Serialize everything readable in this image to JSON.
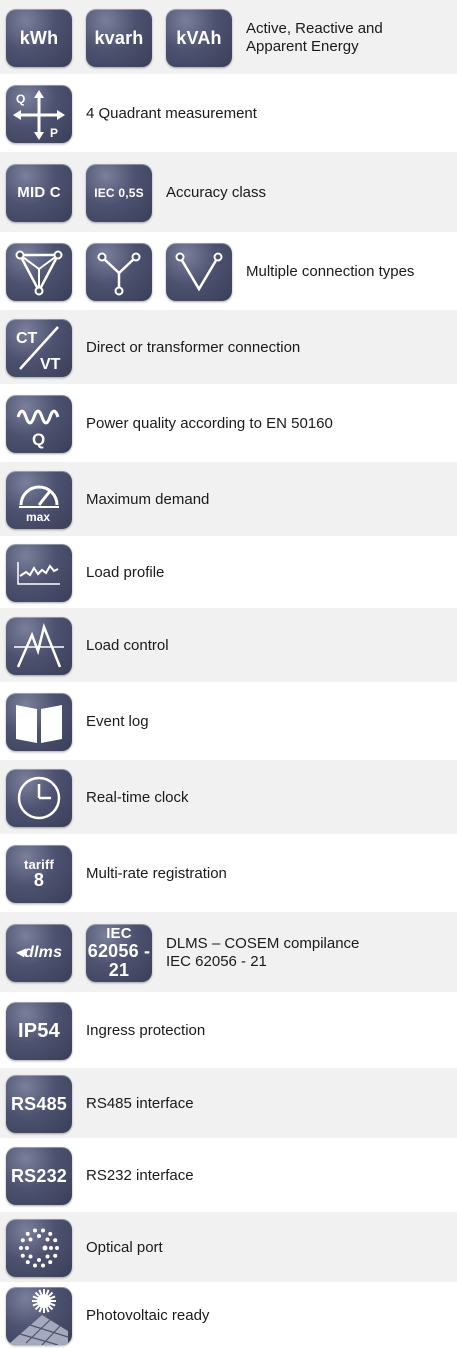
{
  "features": [
    {
      "icons": [
        "kWh",
        "kvarh",
        "kVAh"
      ],
      "label": "Active, Reactive and\nApparent Energy"
    },
    {
      "icons": [
        "quadrant-icon"
      ],
      "label": "4 Quadrant measurement"
    },
    {
      "icons": [
        "MID C",
        "IEC 0,5S"
      ],
      "label": "Accuracy class"
    },
    {
      "icons": [
        "delta-connection-icon",
        "star-connection-icon",
        "v-connection-icon"
      ],
      "label": "Multiple connection types"
    },
    {
      "icons": [
        "ct-vt-icon"
      ],
      "label": "Direct or transformer connection"
    },
    {
      "icons": [
        "power-quality-icon"
      ],
      "label": "Power quality according to EN 50160"
    },
    {
      "icons": [
        "max-demand-icon"
      ],
      "label": "Maximum demand"
    },
    {
      "icons": [
        "load-profile-icon"
      ],
      "label": "Load profile"
    },
    {
      "icons": [
        "load-control-icon"
      ],
      "label": "Load control"
    },
    {
      "icons": [
        "event-log-icon"
      ],
      "label": "Event log"
    },
    {
      "icons": [
        "clock-icon"
      ],
      "label": "Real-time clock"
    },
    {
      "icons": [
        "tariff-icon"
      ],
      "label": "Multi-rate registration"
    },
    {
      "icons": [
        "dlms-icon",
        "iec-62056-icon"
      ],
      "label": "DLMS – COSEM compilance\nIEC 62056 - 21"
    },
    {
      "icons": [
        "IP54"
      ],
      "label": "Ingress protection"
    },
    {
      "icons": [
        "RS485"
      ],
      "label": "RS485 interface"
    },
    {
      "icons": [
        "RS232"
      ],
      "label": "RS232 interface"
    },
    {
      "icons": [
        "optical-port-icon"
      ],
      "label": "Optical port"
    },
    {
      "icons": [
        "photovoltaic-icon"
      ],
      "label": "Photovoltaic ready"
    }
  ],
  "icon_text": {
    "kwh": "kWh",
    "kvarh": "kvarh",
    "kvah": "kVAh",
    "q": "Q",
    "p": "P",
    "mid": "MID C",
    "iec05s": "IEC 0,5S",
    "ct": "CT",
    "vt": "VT",
    "q2": "Q",
    "max": "max",
    "tariff": "tariff",
    "tariff_num": "8",
    "dlms": "dlms",
    "iec": "IEC",
    "iec_num": "62056 - 21",
    "ip54": "IP54",
    "rs485": "RS485",
    "rs232": "RS232"
  },
  "colors": {
    "icon_dark": "#3a3e58",
    "icon_light": "#7a7f9b",
    "row_shade": "#f1f1f1"
  }
}
